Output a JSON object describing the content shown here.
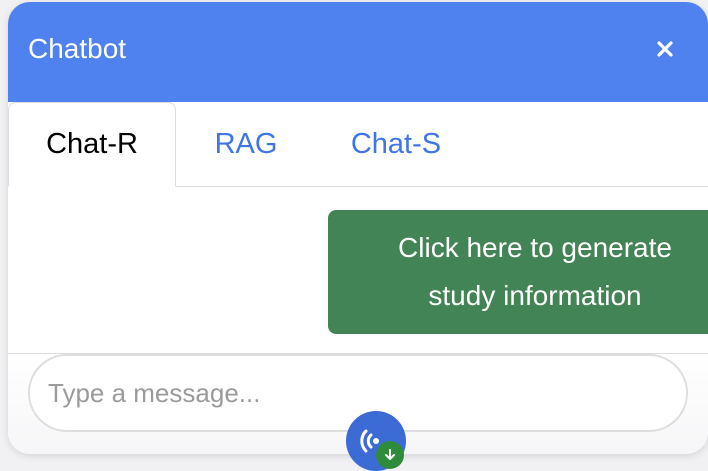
{
  "header": {
    "title": "Chatbot",
    "close_icon": "close-icon",
    "color": "#4f82ef"
  },
  "tabs": [
    {
      "label": "Chat-R",
      "active": true
    },
    {
      "label": "RAG",
      "active": false
    },
    {
      "label": "Chat-S",
      "active": false
    }
  ],
  "messages": {
    "action_bubble": {
      "line1": "Click here to generate",
      "line2": "study information",
      "color": "#428455"
    }
  },
  "composer": {
    "placeholder": "Type a message...",
    "value": ""
  },
  "floating_button": {
    "icon": "broadcast-icon",
    "badge_icon": "download-arrow-icon"
  },
  "colors": {
    "accent": "#4f82ef",
    "tab_link": "#3f76e4",
    "badge": "#2e8b3c"
  }
}
